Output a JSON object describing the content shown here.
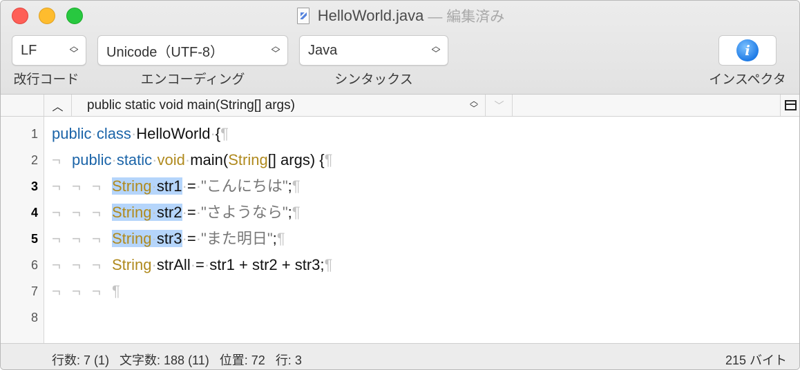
{
  "window": {
    "title": "HelloWorld.java",
    "subtitle": "— 編集済み"
  },
  "toolbar": {
    "line_ending": {
      "value": "LF",
      "label": "改行コード"
    },
    "encoding": {
      "value": "Unicode（UTF-8）",
      "label": "エンコーディング"
    },
    "syntax": {
      "value": "Java",
      "label": "シンタックス"
    },
    "inspector": {
      "label": "インスペクタ",
      "icon": "info-icon"
    }
  },
  "navbar": {
    "selected_symbol": "public static void main(String[] args)"
  },
  "editor": {
    "line_numbers": [
      "1",
      "2",
      "3",
      "4",
      "5",
      "6",
      "7",
      "8"
    ],
    "current_lines": [
      3,
      4,
      5
    ],
    "lines": {
      "l1": {
        "kw1": "public",
        "kw2": "class",
        "name": "HelloWorld",
        "brace": "{",
        "eol": "¶"
      },
      "l2": {
        "kw1": "public",
        "kw2": "static",
        "kw3": "void",
        "name": "main(",
        "type": "String",
        "rest": "[] args) {",
        "eol": "¶"
      },
      "l3": {
        "type": "String",
        "var": "str1",
        "eq": "=",
        "val": "\"こんにちは\"",
        "semi": ";",
        "eol": "¶"
      },
      "l4": {
        "type": "String",
        "var": "str2",
        "eq": "=",
        "val": "\"さようなら\"",
        "semi": ";",
        "eol": "¶"
      },
      "l5": {
        "type": "String",
        "var": "str3",
        "eq": "=",
        "val": "\"また明日\"",
        "semi": ";",
        "eol": "¶"
      },
      "l6": {
        "type": "String",
        "var": "strAll",
        "eq": "=",
        "rest": "str1 + str2 + str3;",
        "eol": "¶"
      },
      "l7": {
        "eol": "¶"
      }
    },
    "invisible_tab": "¬",
    "invisible_space": "·"
  },
  "status": {
    "lines": "行数: 7 (1)",
    "chars": "文字数: 188 (11)",
    "position": "位置: 72",
    "line": "行: 3",
    "size": "215 バイト"
  },
  "colors": {
    "keyword": "#1b64a8",
    "type": "#b08a1e",
    "string": "#777777",
    "selection": "#b5d5fb",
    "invisible": "#c4c4c4"
  }
}
